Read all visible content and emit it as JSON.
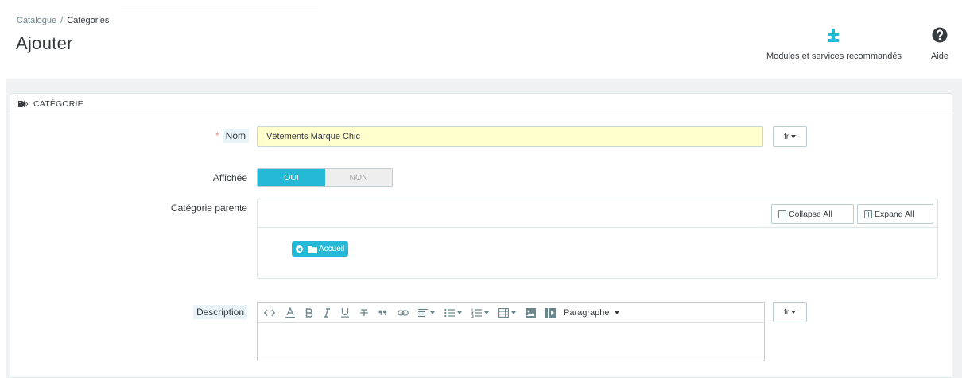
{
  "breadcrumb": {
    "parent": "Catalogue",
    "separator": "/",
    "current": "Catégories"
  },
  "page_title": "Ajouter",
  "toolbar": {
    "modules_label": "Modules et services recommandés",
    "help_label": "Aide",
    "icons": [
      "puzzle-icon",
      "question-circle-icon"
    ]
  },
  "panel": {
    "heading": "CATÉGORIE",
    "name_field": {
      "required_mark": "*",
      "label": "Nom",
      "value": "Vêtements Marque Chic",
      "lang": "fr"
    },
    "displayed": {
      "label": "Affichée",
      "on": "OUI",
      "off": "NON",
      "selected": "OUI"
    },
    "parent_category": {
      "label": "Catégorie parente",
      "collapse_all": "Collapse All",
      "expand_all": "Expand All",
      "root_node": "Accueil"
    },
    "description": {
      "label": "Description",
      "format_select": "Paragraphe",
      "lang": "fr"
    }
  },
  "colors": {
    "accent": "#25b9d7",
    "required_field_bg": "#fffecc",
    "page_bg": "#eff1f2"
  }
}
